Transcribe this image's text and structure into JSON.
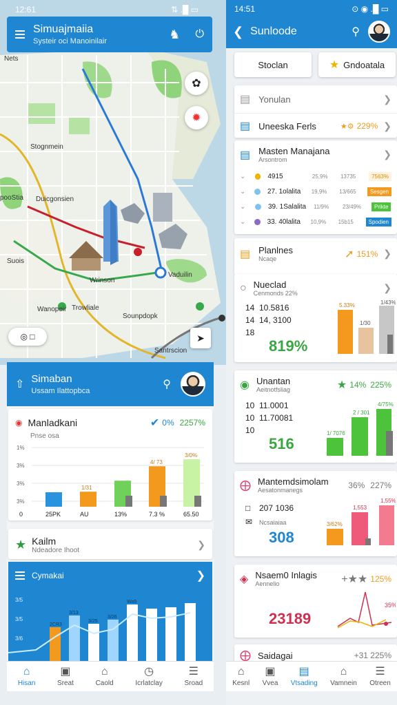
{
  "left_app": {
    "status": {
      "time": "12:61",
      "icons": "⇅ .█ ▭"
    },
    "appbar": {
      "title": "Simuajmaiia",
      "subtitle": "Systeir oci Manoinilair"
    },
    "map_labels": [
      "Nets",
      "Stognmein",
      "Duicgonsien",
      "pooStia",
      "Suois",
      "Wanopeir",
      "Vaduilin",
      "Wrinson",
      "Trowliale",
      "Sounpdopk",
      "Santrscion"
    ],
    "panel": {
      "title": "Simaban",
      "subtitle": "Ussam Ilattopbca",
      "chart_card": {
        "title": "Manladkani",
        "subtitle": "Pnse osa",
        "check_text": "0%",
        "value_text": "2257%",
        "y_ticks": [
          "3%",
          "3%",
          "3%",
          "1%"
        ],
        "x_labels": [
          "0",
          "25PK",
          "AU",
          "13%",
          "7.3 %",
          "65.50"
        ],
        "bar_labels": [
          "",
          "1/31",
          "",
          "4/ 73",
          "3/0%"
        ]
      },
      "kailm_card": {
        "title": "Kailm",
        "subtitle": "Ndeadore Ihoot"
      },
      "blue_card": {
        "title": "Cymakai",
        "y_ticks": [
          "3/5",
          "3/5",
          "3/6"
        ],
        "bar_labels": [
          "2CR3",
          "3/13",
          "3/25",
          "3/26",
          "Wa9"
        ]
      }
    },
    "nav": [
      "Hisan",
      "Sreat",
      "Caold",
      "Icrlatclay",
      "Sroad"
    ]
  },
  "right_app": {
    "status": {
      "time": "14:51",
      "icons": "⊙ ◉ .█ ▭"
    },
    "appbar": {
      "title": "Sunloode"
    },
    "segments": [
      "Stoclan",
      "Gndoatala"
    ],
    "rows": [
      {
        "title": "Yonulan",
        "value": ""
      },
      {
        "title": "Uneeska Ferls",
        "value": "229%"
      }
    ],
    "table_card": {
      "title": "Masten Manajana",
      "subtitle": "Arsontrom",
      "rows": [
        {
          "a": "4915",
          "b": "25,9%",
          "c": "13735",
          "badge": "7563%"
        },
        {
          "a": "27. 1olalita",
          "b": "19,9%",
          "c": "13/665",
          "badge": "Sesgen"
        },
        {
          "a": "39. 1Salalita",
          "b": "11/9%",
          "c": "23/49%",
          "badge": "Prikte"
        },
        {
          "a": "33. 40lalita",
          "b": "10,9%",
          "c": "15b15",
          "badge": "Spodien"
        }
      ]
    },
    "plan_card": {
      "title": "Planlnes",
      "subtitle": "Ncaqe",
      "value": "151%"
    },
    "nuclead": {
      "title": "Nueclad",
      "subtitle": "Cenmonds 22%",
      "rows": [
        {
          "k": "14",
          "v": "10.5816"
        },
        {
          "k": "14",
          "v": "14, 3100"
        },
        {
          "k": "18",
          "v": ""
        }
      ],
      "big": "819%",
      "bar_labels": [
        "5.33%",
        "1/30",
        "1/43%"
      ]
    },
    "unantan": {
      "title": "Unantan",
      "subtitle": "Aeitnotfsliag",
      "value_left": "14%",
      "value_right": "225%",
      "rows": [
        {
          "k": "10",
          "v": "11.0001"
        },
        {
          "k": "10",
          "v": "11.70081"
        },
        {
          "k": "10",
          "v": ""
        }
      ],
      "big": "516",
      "bar_labels": [
        "1/ 7076",
        "2 / 301",
        "4/75%"
      ]
    },
    "mantem": {
      "title": "Mantemdsimolam",
      "value_left": "36%",
      "value_right": "227%",
      "subtitle": "Aesatonmanegs",
      "rows": [
        {
          "k": "",
          "v": "207 1036"
        },
        {
          "k": "",
          "v": "Ncsaiaiaa"
        }
      ],
      "big": "308",
      "bar_labels": [
        "3/62%",
        "1,553",
        "1,55%"
      ]
    },
    "nsaemo": {
      "title": "Nsaem0 Inlagis",
      "subtitle": "Aennelio",
      "value_right": "125%",
      "big": "23189",
      "mini": "35%"
    },
    "saidagai": {
      "title": "Saidagai",
      "value": "+31 225%"
    },
    "nav": [
      "Kesnl",
      "Vvea",
      "Vtsading",
      "Vamnein",
      "Otreen"
    ]
  },
  "colors": {
    "primary": "#1f86d2",
    "orange": "#f39a1e",
    "green": "#4cc33b",
    "pink": "#ef5a7a",
    "lime": "#c8f2a4"
  },
  "chart_data": [
    {
      "type": "bar",
      "title": "Manladkani",
      "categories": [
        "25PK",
        "AU",
        "13%",
        "7.3 %",
        "65.50"
      ],
      "series": [
        {
          "values": [
            25,
            26,
            45,
            70,
            82
          ]
        }
      ],
      "ylim": [
        0,
        100
      ]
    },
    {
      "type": "bar",
      "title": "Cymakai",
      "categories": [
        "1",
        "2",
        "3",
        "4",
        "5",
        "6",
        "7",
        "8"
      ],
      "series": [
        {
          "values": [
            55,
            72,
            60,
            66,
            88,
            82,
            84,
            90
          ]
        }
      ],
      "ylim": [
        0,
        100
      ]
    }
  ]
}
